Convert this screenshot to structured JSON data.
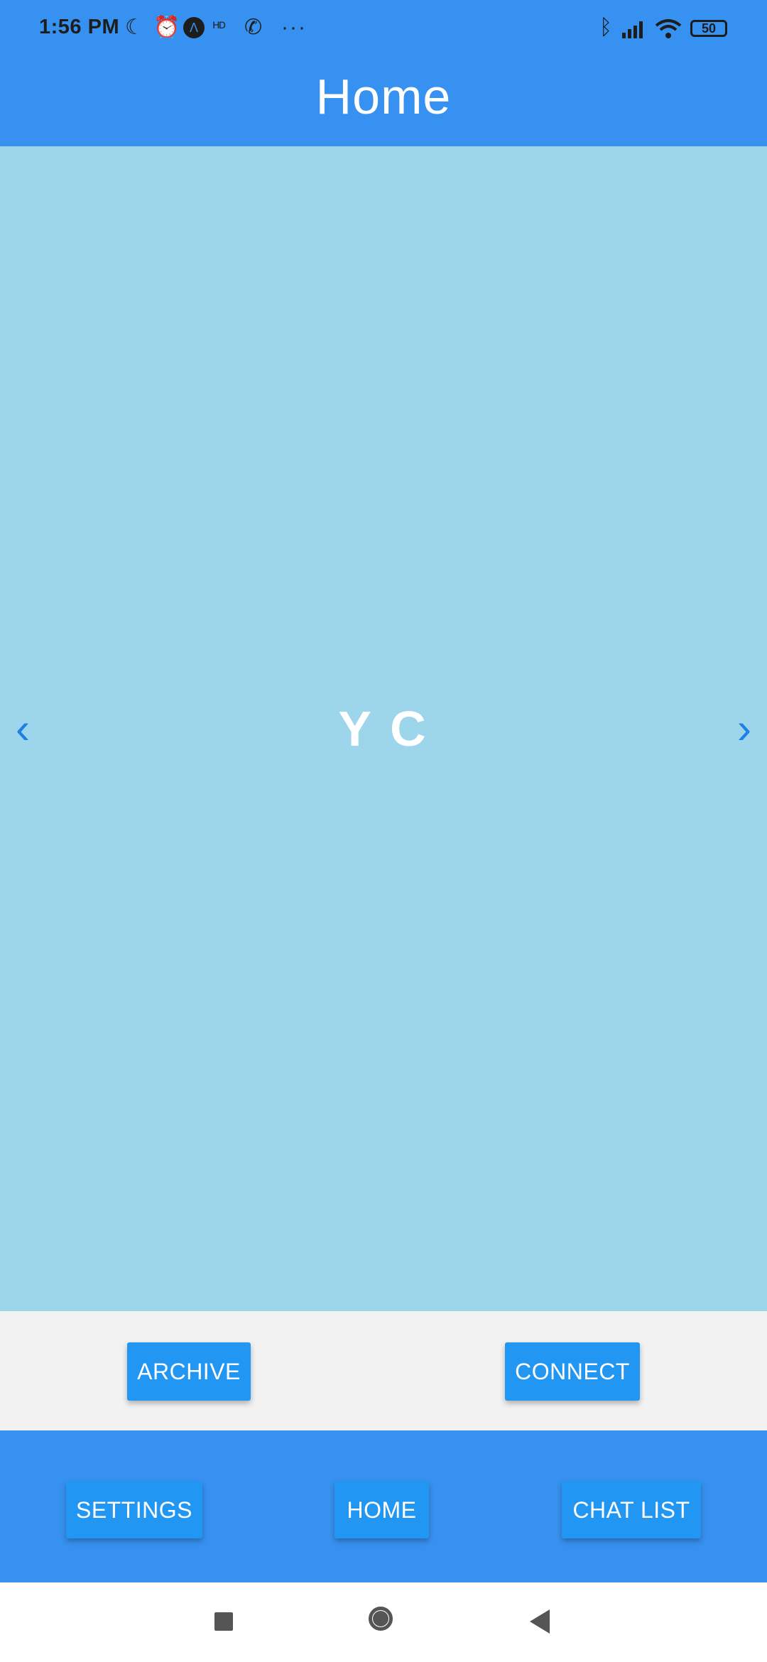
{
  "status_bar": {
    "time": "1:56 PM",
    "left_icons": [
      "moon-icon",
      "alarm-icon",
      "app-icon",
      "hd-icon",
      "whatsapp-icon",
      "more-dots-icon"
    ],
    "right_icons": [
      "bluetooth-icon",
      "signal-icon",
      "wifi-icon"
    ],
    "battery": "50"
  },
  "header": {
    "title": "Home"
  },
  "profile": {
    "initials": "Y C",
    "prev_icon": "‹",
    "next_icon": "›"
  },
  "actions": {
    "archive": "ARCHIVE",
    "connect": "CONNECT"
  },
  "bottom_nav": {
    "settings": "SETTINGS",
    "home": "HOME",
    "chat_list": "CHAT LIST"
  },
  "colors": {
    "primary": "#3791F0",
    "button": "#2196F3",
    "card": "#9DD5EA",
    "arrow": "#1E7FE6"
  }
}
